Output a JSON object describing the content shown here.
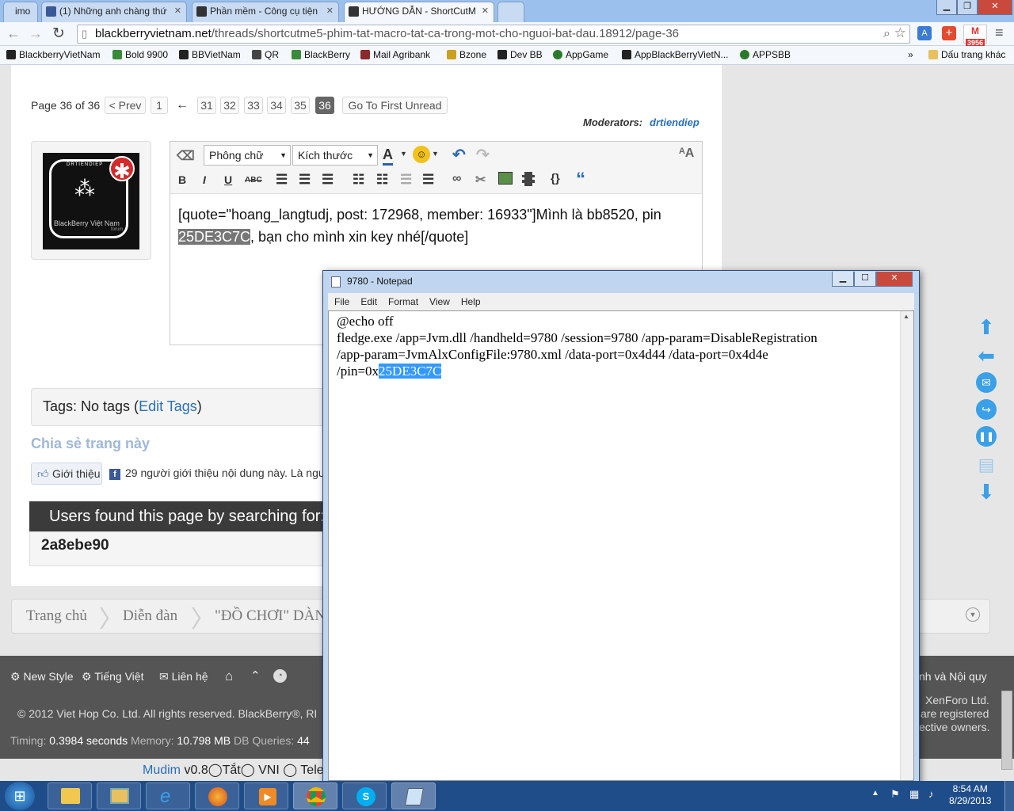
{
  "browser": {
    "tabs": [
      {
        "label": "imo"
      },
      {
        "label": "(1) Những anh chàng thứ"
      },
      {
        "label": "Phần mềm - Công cụ tiện"
      },
      {
        "label": "HƯỚNG DẪN - ShortCutM"
      }
    ],
    "url_host": "blackberryvietnam.net",
    "url_path": "/threads/shortcutme5-phim-tat-macro-tat-ca-trong-mot-cho-nguoi-bat-dau.18912/page-36",
    "gmail_count": "3956",
    "bookmarks": [
      "BlackberryVietNam",
      "Bold 9900",
      "BBVietNam",
      "QR",
      "BlackBerry",
      "Mail Agribank",
      "Bzone",
      "Dev BB",
      "AppGame",
      "AppBlackBerryVietN...",
      "APPSBB"
    ],
    "bookmarks_more": "»",
    "other_bookmarks": "Dấu trang khác"
  },
  "pagination": {
    "summary": "Page 36 of 36",
    "prev": "< Prev",
    "first": "1",
    "arrow": "←",
    "pages": [
      "31",
      "32",
      "33",
      "34",
      "35",
      "36"
    ],
    "go_first_unread": "Go To First Unread"
  },
  "moderators": {
    "label": "Moderators:",
    "name": "drtiendiep"
  },
  "avatar": {
    "top": "DRTIENDIEP",
    "caption": "BlackBerry Việt Nam",
    "small": "forum"
  },
  "editor": {
    "font_select": "Phông chữ",
    "size_select": "Kích thước",
    "buttons": {
      "bold": "B",
      "italic": "I",
      "underline": "U",
      "strike": "ABC",
      "code": "{}",
      "quote": "“"
    },
    "text_before": "[quote=\"hoang_langtudj, post: 172968, member: 16933\"]Mình là bb8520, pin ",
    "text_pin": "25DE3C7C",
    "text_after": ", bạn cho mình xin key nhé[/quote]"
  },
  "tags": {
    "label": "Tags: No tags (",
    "link": "Edit Tags",
    "close": ")"
  },
  "share": {
    "title": "Chia sẻ trang này",
    "like_button": "Giới thiệu",
    "like_text": "29 người giới thiệu nội dung này. Là ngư"
  },
  "users_found": {
    "title": "Users found this page by searching for:",
    "term": "2a8ebe90"
  },
  "breadcrumb": [
    "Trang chủ",
    "Diễn đàn",
    "\"ĐỒ CHƠI\" DÀNH"
  ],
  "footer": {
    "new_style": "New Style",
    "language": "Tiếng Việt",
    "contact": "Liên hệ",
    "rules": "nh và Nội quy",
    "copyright": "© 2012 Viet Hop Co. Ltd. All rights reserved. BlackBerry®, RI",
    "xenforo": "XenForo Ltd.",
    "registered": "are registered",
    "owners": "ective owners.",
    "timing_label": "Timing: ",
    "timing_value": "0.3984 seconds",
    "memory_label": " Memory: ",
    "memory_value": "10.798 MB",
    "db_label": " DB Queries: ",
    "db_value": "44"
  },
  "mudim": {
    "label": "Mudim",
    "version": "v0.8",
    "off": "Tắt",
    "vni": "VNI",
    "telex": "Tele"
  },
  "notepad": {
    "title": "9780 - Notepad",
    "menu": [
      "File",
      "Edit",
      "Format",
      "View",
      "Help"
    ],
    "lines": [
      "@echo off",
      "fledge.exe /app=Jvm.dll /handheld=9780 /session=9780 /app-param=DisableRegistration",
      "/app-param=JvmAlxConfigFile:9780.xml /data-port=0x4d44 /data-port=0x4d4e"
    ],
    "last_prefix": "/pin=0x",
    "last_selected": "25DE3C7C"
  },
  "taskbar": {
    "time": "8:54 AM",
    "date": "8/29/2013"
  },
  "colors": {
    "tabbar": "#9bc0ee",
    "footer": "#555555",
    "taskbar": "#1f4d8a",
    "selection": "#3399ff",
    "link": "#2a6fb8"
  }
}
